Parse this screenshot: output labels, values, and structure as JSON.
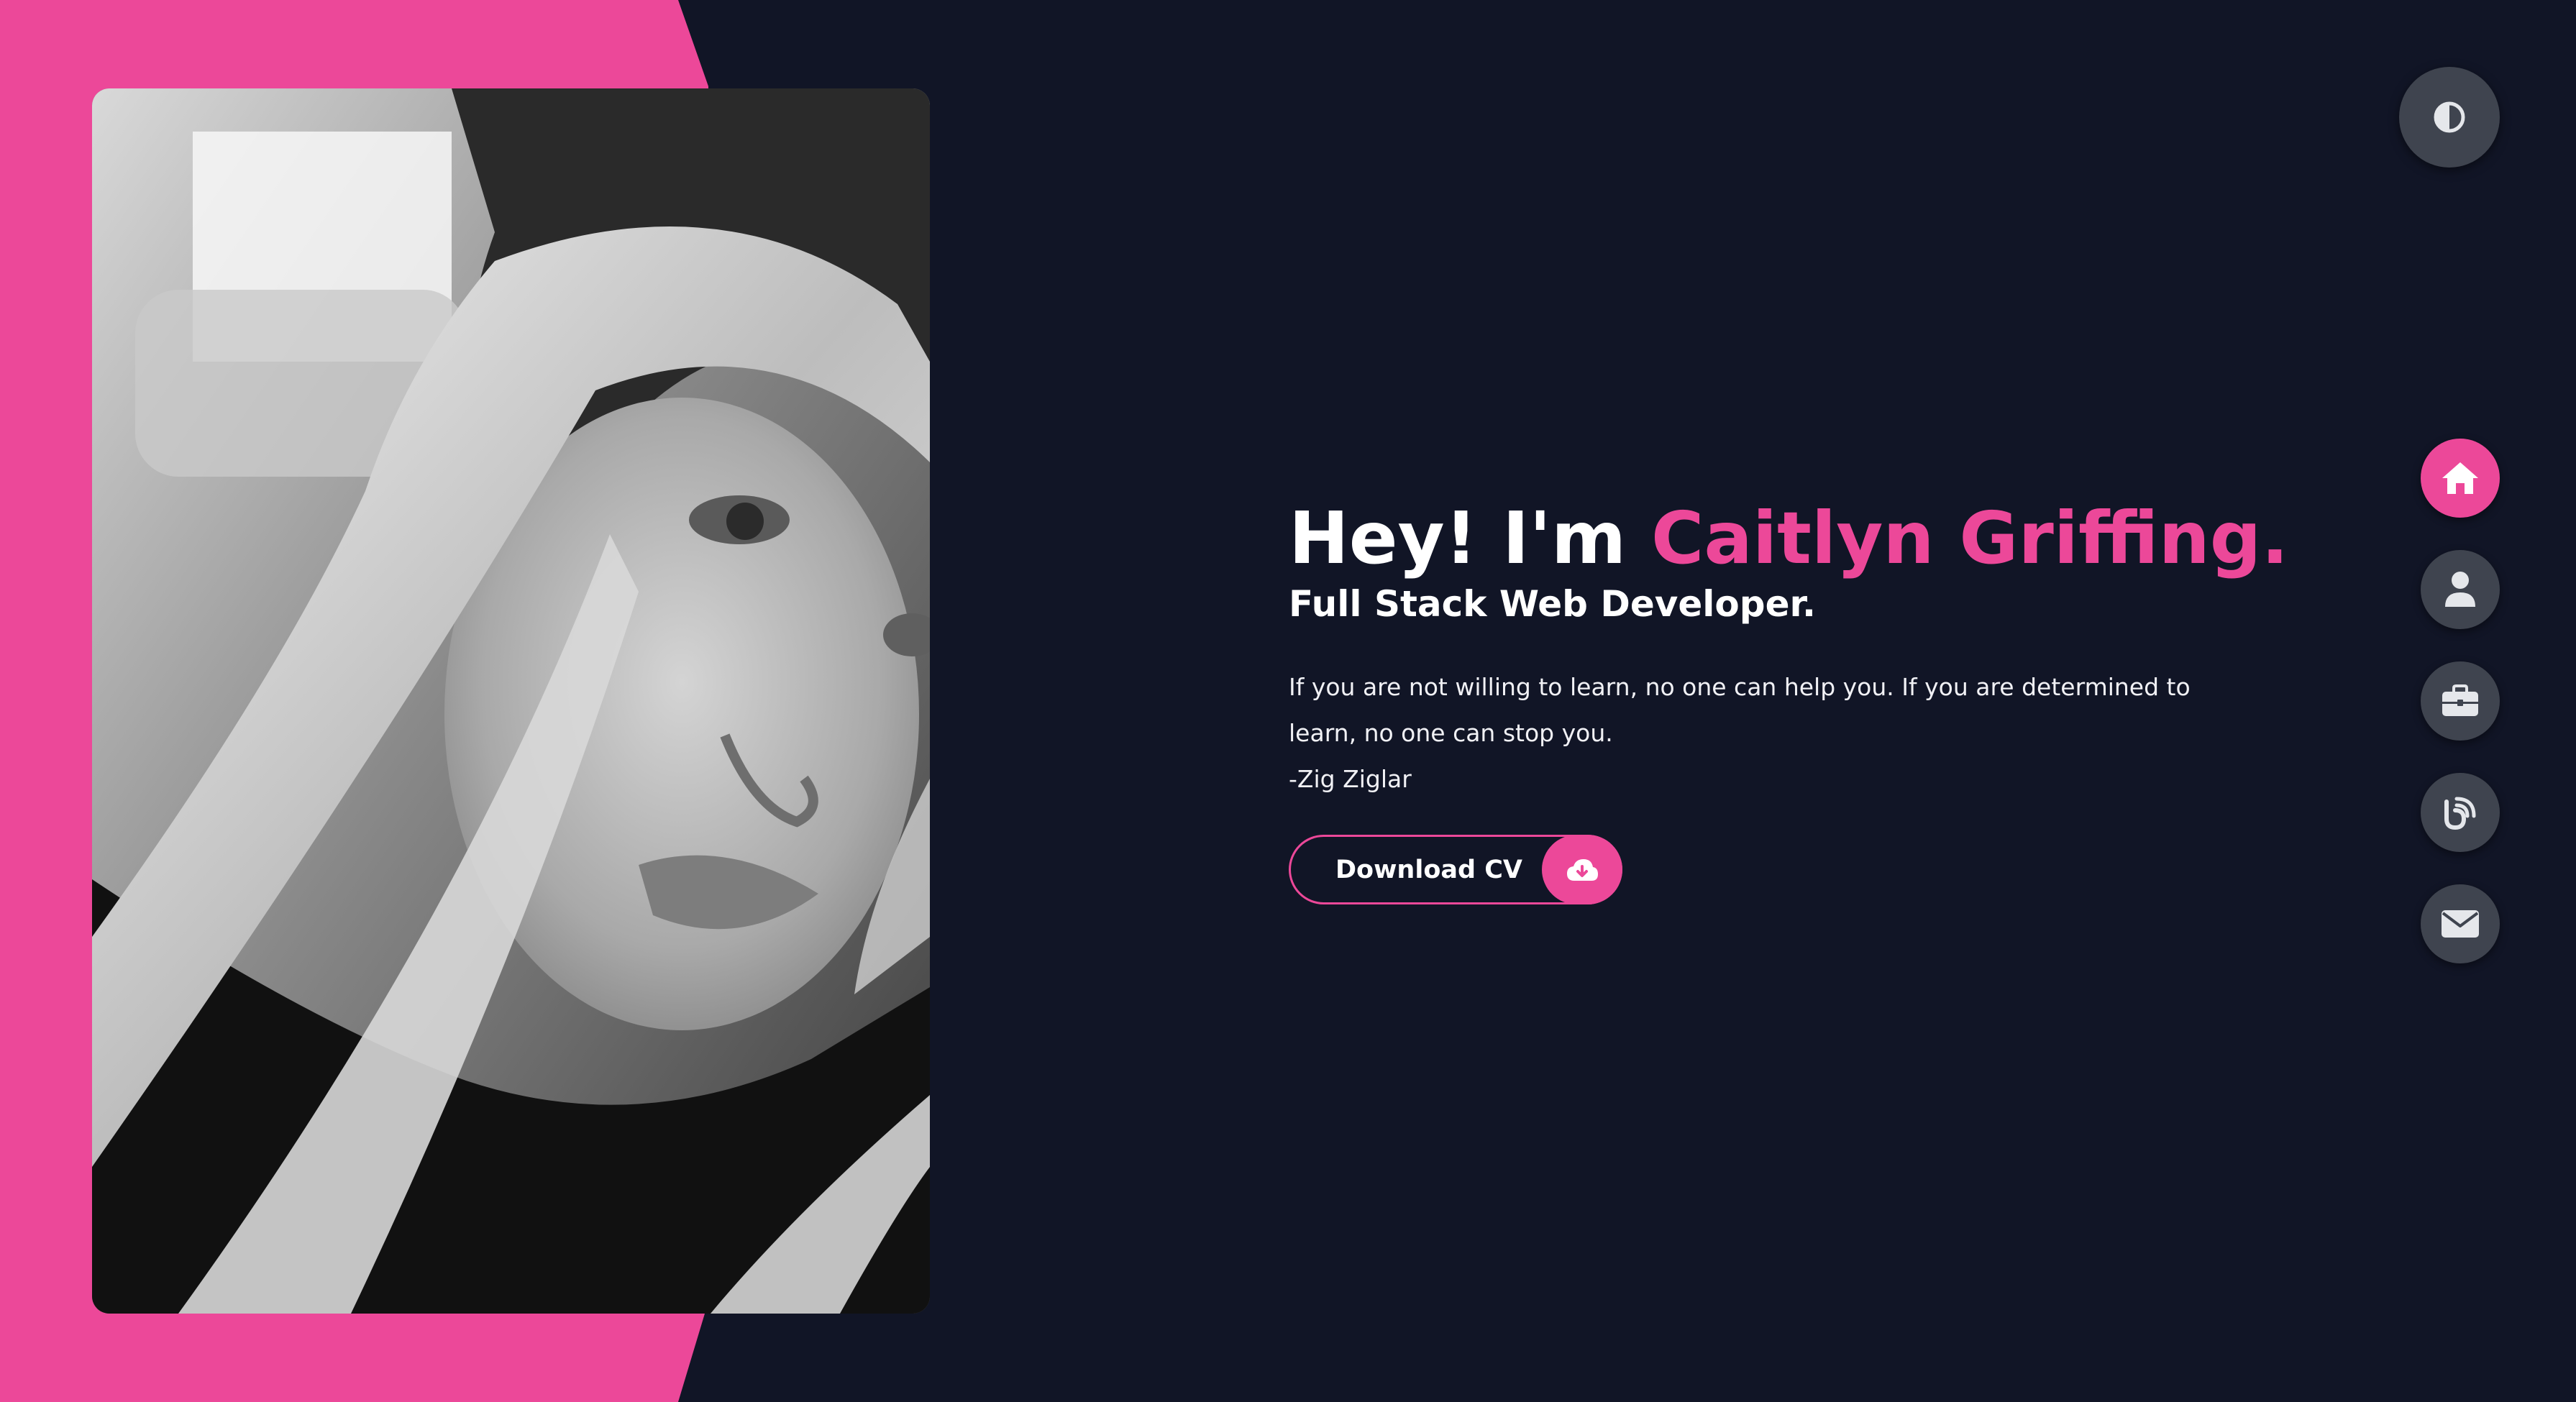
{
  "hero": {
    "greeting": "Hey! I'm",
    "name": "Caitlyn Griffing.",
    "role": "Full Stack Web Developer.",
    "quote": "If you are not willing to learn, no one can help you. If you are determined to learn, no one can stop you.",
    "quote_author": "-Zig Ziglar",
    "download_label": "Download CV"
  },
  "icons": {
    "theme_toggle": "half-circle-contrast-icon",
    "download": "cloud-download-icon",
    "nav": [
      "home-icon",
      "user-icon",
      "briefcase-icon",
      "blog-icon",
      "envelope-icon"
    ]
  },
  "colors": {
    "background": "#111526",
    "accent": "#ec4899",
    "button": "#3f444f",
    "text": "#ffffff"
  }
}
